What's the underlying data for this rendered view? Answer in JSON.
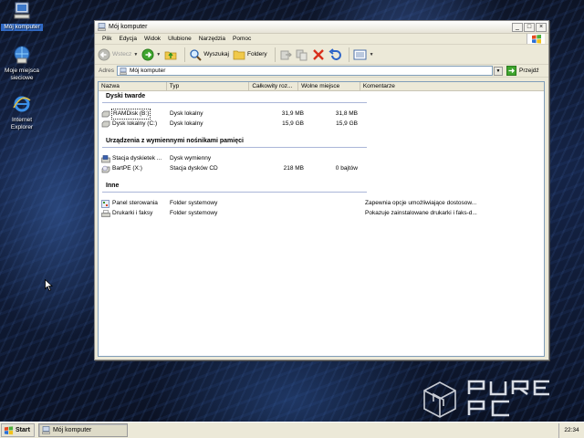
{
  "desktop": {
    "icons": [
      {
        "label": "Mój komputer"
      },
      {
        "label": "Moje miejsca sieciowe"
      },
      {
        "label": "Internet Explorer"
      }
    ],
    "logo": "PURE PC"
  },
  "window": {
    "title": "Mój komputer",
    "buttons": {
      "minimize": "_",
      "maximize": "□",
      "close": "×"
    },
    "menu": [
      "Plik",
      "Edycja",
      "Widok",
      "Ulubione",
      "Narzędzia",
      "Pomoc"
    ],
    "toolbar": {
      "back": "Wstecz",
      "search": "Wyszukaj",
      "folders": "Foldery"
    },
    "address": {
      "label": "Adres",
      "value": "Mój komputer",
      "go": "Przejdź"
    },
    "columns": [
      "Nazwa",
      "Typ",
      "Całkowity roz...",
      "Wolne miejsce",
      "Komentarze"
    ],
    "groups": [
      {
        "title": "Dyski twarde",
        "items": [
          {
            "name": "RAMDisk (B:)",
            "type": "Dysk lokalny",
            "total": "31,9 MB",
            "free": "31,8 MB",
            "comment": ""
          },
          {
            "name": "Dysk lokalny (C:)",
            "type": "Dysk lokalny",
            "total": "15,9 GB",
            "free": "15,9 GB",
            "comment": ""
          }
        ]
      },
      {
        "title": "Urządzenia z wymiennymi nośnikami pamięci",
        "items": [
          {
            "name": "Stacja dyskietek ...",
            "type": "Dysk wymienny",
            "total": "",
            "free": "",
            "comment": ""
          },
          {
            "name": "BartPE (X:)",
            "type": "Stacja dysków CD",
            "total": "218 MB",
            "free": "0 bajtów",
            "comment": ""
          }
        ]
      },
      {
        "title": "Inne",
        "items": [
          {
            "name": "Panel sterowania",
            "type": "Folder systemowy",
            "total": "",
            "free": "",
            "comment": "Zapewnia opcje umożliwiające dostosow..."
          },
          {
            "name": "Drukarki i faksy",
            "type": "Folder systemowy",
            "total": "",
            "free": "",
            "comment": "Pokazuje zainstalowane drukarki i faks-d..."
          }
        ]
      }
    ]
  },
  "taskbar": {
    "start": "Start",
    "task": "Mój komputer",
    "clock": "22:34"
  }
}
